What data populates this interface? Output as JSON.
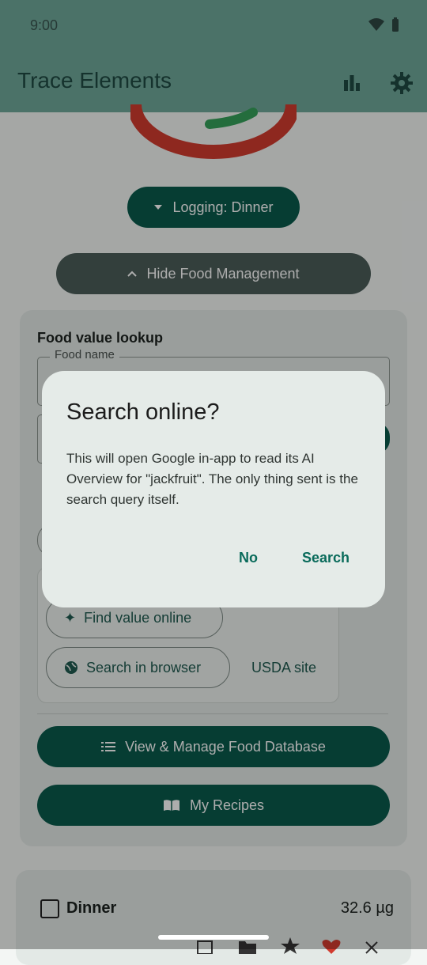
{
  "status_bar": {
    "time": "9:00"
  },
  "app_bar": {
    "title": "Trace Elements"
  },
  "logging_button": {
    "label": "Logging: Dinner"
  },
  "hide_food_button": {
    "label": "Hide Food Management"
  },
  "food_lookup": {
    "title": "Food value lookup",
    "food_name_label": "Food name",
    "find_value_online": "Find value online",
    "search_in_browser": "Search in browser",
    "usda_site": "USDA site"
  },
  "view_db_button": {
    "label": "View & Manage Food Database"
  },
  "recipes_button": {
    "label": "My Recipes"
  },
  "meal_row": {
    "label": "Dinner",
    "value": "32.6 µg"
  },
  "dialog": {
    "title": "Search online?",
    "body": "This will open Google in-app to read its AI Overview for \"jackfruit\". The only thing sent is the search query itself.",
    "no_label": "No",
    "search_label": "Search"
  },
  "colors": {
    "accent": "#0a5a4c",
    "app_bar": "#6fa89a",
    "gauge_red": "#d23b2f",
    "gauge_green": "#35a15a"
  }
}
